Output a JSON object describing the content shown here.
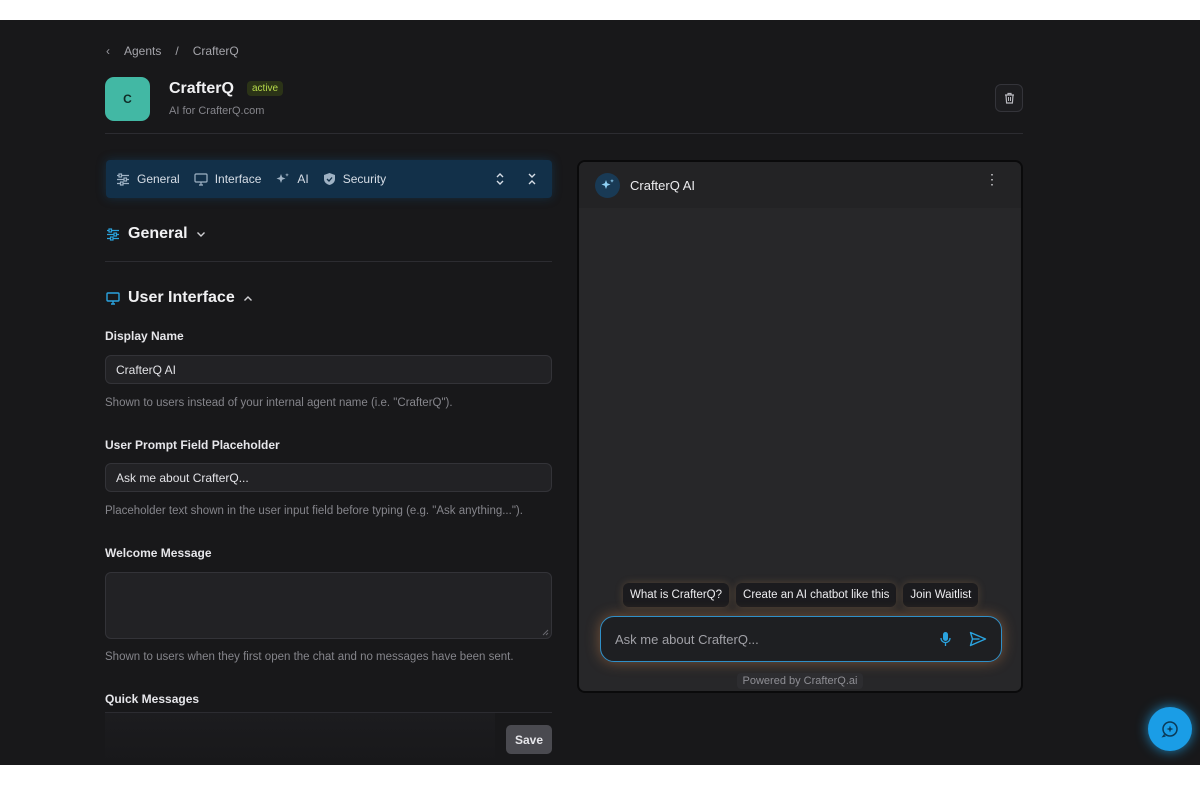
{
  "breadcrumb": {
    "parent": "Agents",
    "separator": "/",
    "current": "CrafterQ"
  },
  "agent": {
    "avatar_letter": "C",
    "name": "CrafterQ",
    "status": "active",
    "subtitle": "AI for CrafterQ.com"
  },
  "tabs": [
    {
      "label": "General",
      "icon": "sliders-icon"
    },
    {
      "label": "Interface",
      "icon": "monitor-icon"
    },
    {
      "label": "AI",
      "icon": "sparkles-icon"
    },
    {
      "label": "Security",
      "icon": "shield-icon"
    }
  ],
  "sections": {
    "general": {
      "title": "General",
      "collapsed": true
    },
    "user_interface": {
      "title": "User Interface",
      "collapsed": false
    }
  },
  "form": {
    "display_name": {
      "label": "Display Name",
      "value": "CrafterQ AI",
      "help": "Shown to users instead of your internal agent name (i.e. \"CrafterQ\")."
    },
    "prompt_placeholder": {
      "label": "User Prompt Field Placeholder",
      "value": "Ask me about CrafterQ...",
      "help": "Placeholder text shown in the user input field before typing (e.g. \"Ask anything...\")."
    },
    "welcome_message": {
      "label": "Welcome Message",
      "value": "",
      "help": "Shown to users when they first open the chat and no messages have been sent."
    },
    "quick_messages": {
      "label": "Quick Messages"
    },
    "save_label": "Save"
  },
  "preview": {
    "title": "CrafterQ AI",
    "quick_messages": [
      "What is CrafterQ?",
      "Create an AI chatbot like this",
      "Join Waitlist"
    ],
    "input_placeholder": "Ask me about CrafterQ...",
    "powered_by": "Powered by CrafterQ.ai"
  },
  "colors": {
    "accent": "#1a9de6",
    "avatar": "#42b8a4",
    "status": "#b6d94a",
    "tabbar": "#123049"
  }
}
